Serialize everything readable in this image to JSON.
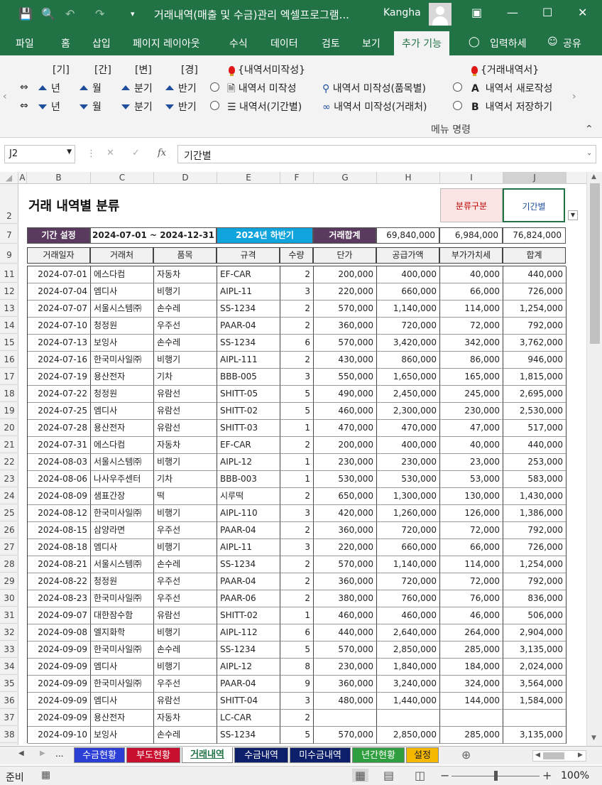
{
  "titlebar": {
    "title": "거래내역(매출 및 수금)관리 엑셀프로그램...",
    "user": "Kangha"
  },
  "menu": {
    "items": [
      "파일",
      "홈",
      "삽입",
      "페이지 레이아웃",
      "수식",
      "데이터",
      "검토",
      "보기",
      "추가 기능",
      "입력하세",
      "공유"
    ],
    "active": "추가 기능"
  },
  "ribbon": {
    "headers": [
      "[기]",
      "[간]",
      "[변]",
      "[경]"
    ],
    "up_labels": [
      "년",
      "월",
      "분기",
      "반기"
    ],
    "down_labels": [
      "년",
      "월",
      "분기",
      "반기"
    ],
    "group1_title": "{내역서미작성}",
    "group1_items": [
      "내역서 미작성",
      "내역서(기간별)"
    ],
    "group2_items": [
      "내역서 미작성(품목별)",
      "내역서 미작성(거래처)"
    ],
    "group3_title": "{거래내역서}",
    "group3_items": [
      "내역서 새로작성",
      "내역서 저장하기"
    ],
    "group3_letters": [
      "A",
      "B"
    ],
    "footer": "메뉴 명령"
  },
  "formula": {
    "namebox": "J2",
    "fx": "fx",
    "value": "기간별"
  },
  "columns": [
    "A",
    "B",
    "C",
    "D",
    "E",
    "F",
    "G",
    "H",
    "I",
    "J"
  ],
  "row_numbers": [
    "2",
    "7",
    "9",
    "11",
    "12",
    "13",
    "14",
    "15",
    "16",
    "17",
    "18",
    "19",
    "20",
    "21",
    "22",
    "23",
    "24",
    "25",
    "26",
    "27",
    "28",
    "29",
    "30",
    "31",
    "32",
    "33",
    "34",
    "35",
    "36",
    "37",
    "38"
  ],
  "sheet": {
    "title": "거래 내역별 분류",
    "classify_label": "분류구분",
    "classify_value": "기간별",
    "period_label": "기간 설정",
    "period_range": "2024-07-01  ~ 2024-12-31",
    "period_name": "2024년 하반기",
    "total_label": "거래합계",
    "total_supply": "69,840,000",
    "total_vat": "6,984,000",
    "total_sum": "76,824,000",
    "headers": [
      "거래일자",
      "거래처",
      "품목",
      "규격",
      "수량",
      "단가",
      "공급가액",
      "부가가치세",
      "합계"
    ],
    "rows": [
      [
        "2024-07-01",
        "에스다컴",
        "자동차",
        "EF-CAR",
        "2",
        "200,000",
        "400,000",
        "40,000",
        "440,000"
      ],
      [
        "2024-07-04",
        "엠디사",
        "비행기",
        "AIPL-11",
        "3",
        "220,000",
        "660,000",
        "66,000",
        "726,000"
      ],
      [
        "2024-07-07",
        "서울시스템㈜",
        "손수레",
        "SS-1234",
        "2",
        "570,000",
        "1,140,000",
        "114,000",
        "1,254,000"
      ],
      [
        "2024-07-10",
        "청정원",
        "우주선",
        "PAAR-04",
        "2",
        "360,000",
        "720,000",
        "72,000",
        "792,000"
      ],
      [
        "2024-07-13",
        "보잉사",
        "손수레",
        "SS-1234",
        "6",
        "570,000",
        "3,420,000",
        "342,000",
        "3,762,000"
      ],
      [
        "2024-07-16",
        "한국미사일㈜",
        "비행기",
        "AIPL-111",
        "2",
        "430,000",
        "860,000",
        "86,000",
        "946,000"
      ],
      [
        "2024-07-19",
        "용산전자",
        "기차",
        "BBB-005",
        "3",
        "550,000",
        "1,650,000",
        "165,000",
        "1,815,000"
      ],
      [
        "2024-07-22",
        "청정원",
        "유람선",
        "SHITT-05",
        "5",
        "490,000",
        "2,450,000",
        "245,000",
        "2,695,000"
      ],
      [
        "2024-07-25",
        "엠디사",
        "유람선",
        "SHITT-02",
        "5",
        "460,000",
        "2,300,000",
        "230,000",
        "2,530,000"
      ],
      [
        "2024-07-28",
        "용산전자",
        "유람선",
        "SHITT-03",
        "1",
        "470,000",
        "470,000",
        "47,000",
        "517,000"
      ],
      [
        "2024-07-31",
        "에스다컴",
        "자동차",
        "EF-CAR",
        "2",
        "200,000",
        "400,000",
        "40,000",
        "440,000"
      ],
      [
        "2024-08-03",
        "서울시스템㈜",
        "비행기",
        "AIPL-12",
        "1",
        "230,000",
        "230,000",
        "23,000",
        "253,000"
      ],
      [
        "2024-08-06",
        "나사우주센터",
        "기차",
        "BBB-003",
        "1",
        "530,000",
        "530,000",
        "53,000",
        "583,000"
      ],
      [
        "2024-08-09",
        "샘표간장",
        "떡",
        "시루떡",
        "2",
        "650,000",
        "1,300,000",
        "130,000",
        "1,430,000"
      ],
      [
        "2024-08-12",
        "한국미사일㈜",
        "비행기",
        "AIPL-110",
        "3",
        "420,000",
        "1,260,000",
        "126,000",
        "1,386,000"
      ],
      [
        "2024-08-15",
        "삼양라면",
        "우주선",
        "PAAR-04",
        "2",
        "360,000",
        "720,000",
        "72,000",
        "792,000"
      ],
      [
        "2024-08-18",
        "엠디사",
        "비행기",
        "AIPL-11",
        "3",
        "220,000",
        "660,000",
        "66,000",
        "726,000"
      ],
      [
        "2024-08-21",
        "서울시스템㈜",
        "손수레",
        "SS-1234",
        "2",
        "570,000",
        "1,140,000",
        "114,000",
        "1,254,000"
      ],
      [
        "2024-08-22",
        "청정원",
        "우주선",
        "PAAR-04",
        "2",
        "360,000",
        "720,000",
        "72,000",
        "792,000"
      ],
      [
        "2024-08-23",
        "한국미사일㈜",
        "우주선",
        "PAAR-06",
        "2",
        "380,000",
        "760,000",
        "76,000",
        "836,000"
      ],
      [
        "2024-09-07",
        "대한잠수함",
        "유람선",
        "SHITT-02",
        "1",
        "460,000",
        "460,000",
        "46,000",
        "506,000"
      ],
      [
        "2024-09-08",
        "엘지화학",
        "비행기",
        "AIPL-112",
        "6",
        "440,000",
        "2,640,000",
        "264,000",
        "2,904,000"
      ],
      [
        "2024-09-09",
        "한국미사일㈜",
        "손수레",
        "SS-1234",
        "5",
        "570,000",
        "2,850,000",
        "285,000",
        "3,135,000"
      ],
      [
        "2024-09-09",
        "엠디사",
        "비행기",
        "AIPL-12",
        "8",
        "230,000",
        "1,840,000",
        "184,000",
        "2,024,000"
      ],
      [
        "2024-09-09",
        "한국미사일㈜",
        "우주선",
        "PAAR-04",
        "9",
        "360,000",
        "3,240,000",
        "324,000",
        "3,564,000"
      ],
      [
        "2024-09-09",
        "엠디사",
        "유람선",
        "SHITT-04",
        "3",
        "480,000",
        "1,440,000",
        "144,000",
        "1,584,000"
      ],
      [
        "2024-09-09",
        "용산전자",
        "자동차",
        "LC-CAR",
        "2",
        "",
        "",
        "",
        ""
      ],
      [
        "2024-09-10",
        "보잉사",
        "손수레",
        "SS-1234",
        "5",
        "570,000",
        "2,850,000",
        "285,000",
        "3,135,000"
      ]
    ]
  },
  "tabs": [
    {
      "label": "수금현황",
      "color": "#2b3fd6"
    },
    {
      "label": "부도현황",
      "color": "#c8102e"
    },
    {
      "label": "거래내역",
      "color": "#ffffff"
    },
    {
      "label": "수금내역",
      "color": "#0d1f6b"
    },
    {
      "label": "미수금내역",
      "color": "#0d1f6b"
    },
    {
      "label": "년간현황",
      "color": "#2e9e3e"
    },
    {
      "label": "설정",
      "color": "#f5b800"
    }
  ],
  "tab_overflow": "...",
  "status": {
    "ready": "준비",
    "zoom": "100%"
  }
}
